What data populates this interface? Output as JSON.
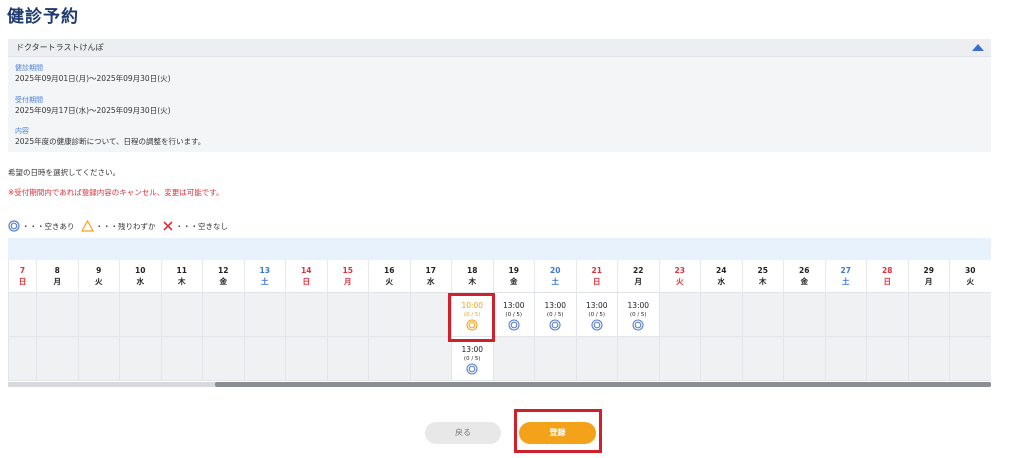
{
  "page_title": "健診予約",
  "info": {
    "header": "ドクタートラストけんぽ",
    "period_label": "健診期間",
    "period_value": "2025年09月01日(月)〜2025年09月30日(火)",
    "accept_label": "受付期間",
    "accept_value": "2025年09月17日(水)〜2025年09月30日(火)",
    "content_label": "内容",
    "content_value": "2025年度の健康診断について、日程の調整を行います。"
  },
  "instruction": "希望の日時を選択してください。",
  "notice": "※受付期間内であれば登録内容のキャンセル、変更は可能です。",
  "legend": {
    "available": "・・・空きあり",
    "few": "・・・残りわずか",
    "none": "・・・空きなし"
  },
  "colors": {
    "sunday": "#e0303b",
    "saturday": "#3a76d6",
    "weekday": "#222222",
    "accent": "#f5a21b",
    "available_icon": "#5b7fcf",
    "selected_icon": "#f5a21b"
  },
  "days": [
    {
      "date": "7",
      "dow": "日",
      "type": "sun"
    },
    {
      "date": "8",
      "dow": "月",
      "type": "weekday"
    },
    {
      "date": "9",
      "dow": "火",
      "type": "weekday"
    },
    {
      "date": "10",
      "dow": "水",
      "type": "weekday"
    },
    {
      "date": "11",
      "dow": "木",
      "type": "weekday"
    },
    {
      "date": "12",
      "dow": "金",
      "type": "weekday"
    },
    {
      "date": "13",
      "dow": "土",
      "type": "sat"
    },
    {
      "date": "14",
      "dow": "日",
      "type": "sun"
    },
    {
      "date": "15",
      "dow": "月",
      "type": "sun"
    },
    {
      "date": "16",
      "dow": "火",
      "type": "weekday"
    },
    {
      "date": "17",
      "dow": "水",
      "type": "weekday"
    },
    {
      "date": "18",
      "dow": "木",
      "type": "weekday"
    },
    {
      "date": "19",
      "dow": "金",
      "type": "weekday"
    },
    {
      "date": "20",
      "dow": "土",
      "type": "sat"
    },
    {
      "date": "21",
      "dow": "日",
      "type": "sun"
    },
    {
      "date": "22",
      "dow": "月",
      "type": "weekday"
    },
    {
      "date": "23",
      "dow": "火",
      "type": "sun"
    },
    {
      "date": "24",
      "dow": "水",
      "type": "weekday"
    },
    {
      "date": "25",
      "dow": "木",
      "type": "weekday"
    },
    {
      "date": "26",
      "dow": "金",
      "type": "weekday"
    },
    {
      "date": "27",
      "dow": "土",
      "type": "sat"
    },
    {
      "date": "28",
      "dow": "日",
      "type": "sun"
    },
    {
      "date": "29",
      "dow": "月",
      "type": "weekday"
    },
    {
      "date": "30",
      "dow": "火",
      "type": "weekday"
    }
  ],
  "slots": [
    {
      "day_index": 11,
      "row": 0,
      "time": "10:00",
      "count": "(0 / 5)",
      "selected": true
    },
    {
      "day_index": 12,
      "row": 0,
      "time": "13:00",
      "count": "(0 / 5)",
      "selected": false
    },
    {
      "day_index": 13,
      "row": 0,
      "time": "13:00",
      "count": "(0 / 5)",
      "selected": false
    },
    {
      "day_index": 14,
      "row": 0,
      "time": "13:00",
      "count": "(0 / 5)",
      "selected": false
    },
    {
      "day_index": 15,
      "row": 0,
      "time": "13:00",
      "count": "(0 / 5)",
      "selected": false
    },
    {
      "day_index": 11,
      "row": 1,
      "time": "13:00",
      "count": "(0 / 5)",
      "selected": false
    }
  ],
  "buttons": {
    "back": "戻る",
    "register": "登録"
  }
}
